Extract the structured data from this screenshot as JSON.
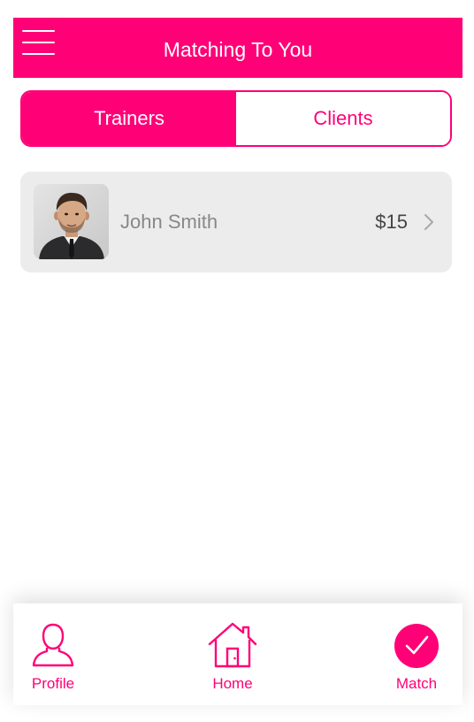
{
  "header": {
    "title": "Matching To You",
    "menu_icon": "hamburger-menu-icon"
  },
  "segment": {
    "tabs": [
      {
        "label": "Trainers",
        "active": true
      },
      {
        "label": "Clients",
        "active": false
      }
    ]
  },
  "matches": [
    {
      "name": "John Smith",
      "price": "$15",
      "avatar": "man-in-suit-photo",
      "chevron_icon": "chevron-right-icon"
    }
  ],
  "tabbar": {
    "items": [
      {
        "label": "Profile",
        "icon": "person-icon"
      },
      {
        "label": "Home",
        "icon": "house-icon"
      },
      {
        "label": "Match",
        "icon": "checkmark-circle-icon",
        "active": true
      }
    ]
  },
  "colors": {
    "accent": "#ff0077",
    "card_background": "#ececec",
    "name_text": "#888888",
    "price_text": "#444444"
  }
}
